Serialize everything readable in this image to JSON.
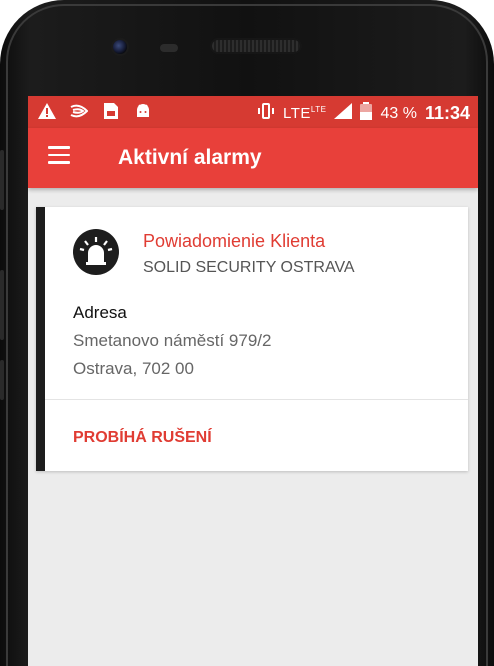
{
  "status_bar": {
    "icons_left": [
      "warning-icon",
      "sound-wave-icon",
      "sim-icon",
      "android-icon"
    ],
    "vibrate_icon": "vibrate-icon",
    "network": "LTE",
    "network_sup": "LTE",
    "signal_icon": "signal-icon",
    "battery_icon": "battery-icon",
    "battery": "43 %",
    "time": "11:34"
  },
  "toolbar": {
    "menu_icon": "menu-icon",
    "title": "Aktivní alarmy"
  },
  "alarm_card": {
    "icon": "siren-icon",
    "title": "Powiadomienie Klienta",
    "client": "SOLID SECURITY OSTRAVA",
    "address_label": "Adresa",
    "address_line1": "Smetanovo náměstí 979/2",
    "address_line2": "Ostrava, 702 00",
    "action_label": "PROBÍHÁ RUŠENÍ"
  },
  "colors": {
    "status_bar": "#d63a32",
    "toolbar": "#e8403a",
    "accent_text": "#e03c33",
    "background": "#ececec"
  }
}
